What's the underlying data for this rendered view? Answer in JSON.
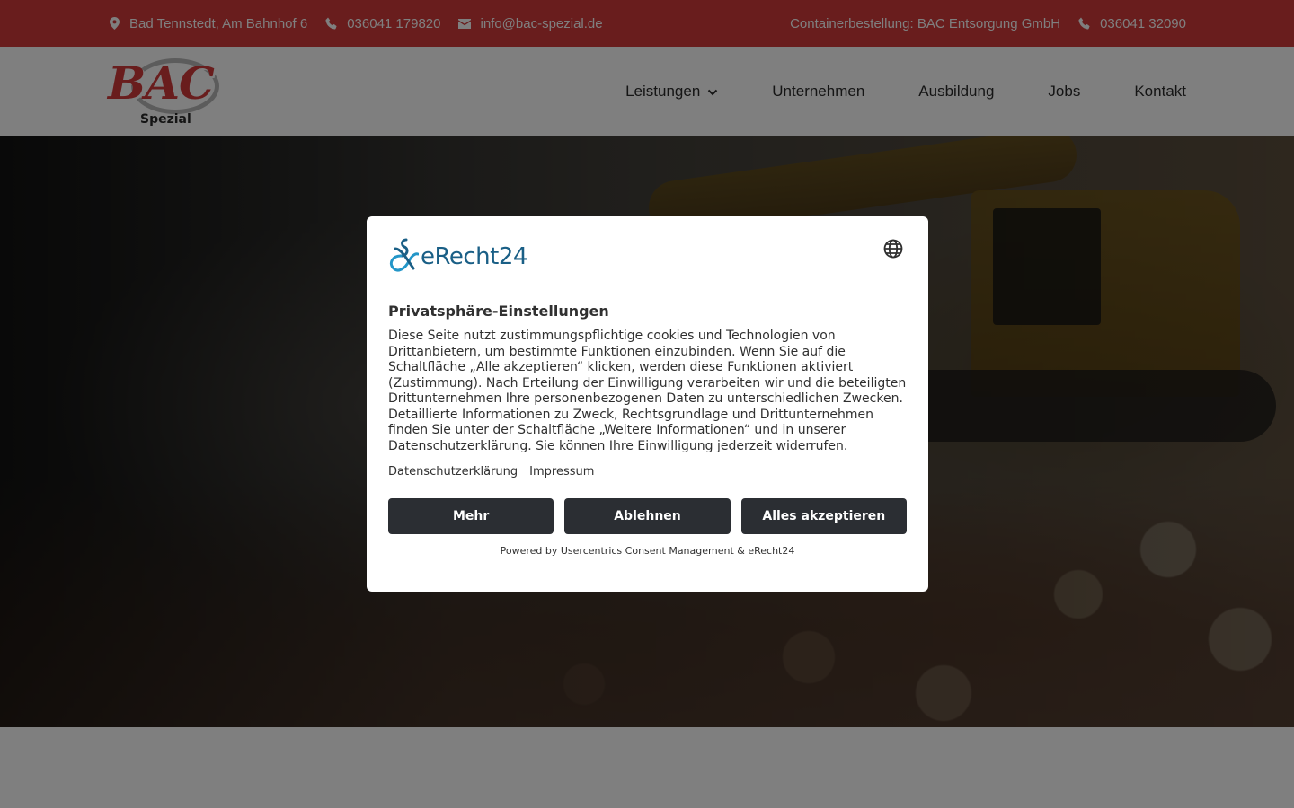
{
  "topbar": {
    "address": "Bad Tennstedt, Am Bahnhof 6",
    "phone": "036041 179820",
    "email": "info@bac-spezial.de",
    "container_order": "Containerbestellung: BAC Entsorgung GmbH",
    "container_phone": "036041 32090"
  },
  "logo": {
    "main": "BAC",
    "sub": "Spezial"
  },
  "nav": {
    "items": [
      {
        "label": "Leistungen"
      },
      {
        "label": "Unternehmen"
      },
      {
        "label": "Ausbildung"
      },
      {
        "label": "Jobs"
      },
      {
        "label": "Kontakt"
      }
    ]
  },
  "consent": {
    "brand": "eRecht24",
    "title": "Privatsphäre-Einstellungen",
    "text": "Diese Seite nutzt zustimmungspflichtige cookies und Technologien von Drittanbietern, um bestimmte Funktionen einzubinden. Wenn Sie auf die Schaltfläche „Alle akzeptieren“ klicken, werden diese Funktionen aktiviert (Zustimmung). Nach Erteilung der Einwilligung verarbeiten wir und die beteiligten Drittunternehmen Ihre personenbezogenen Daten zu unterschiedlichen Zwecken. Detaillierte Informationen zu Zweck, Rechtsgrundlage und Drittunternehmen finden Sie unter der Schaltfläche „Weitere Informationen“ und in unserer Datenschutzerklärung. Sie können Ihre Einwilligung jederzeit widerrufen.",
    "link_privacy": "Datenschutzerklärung",
    "link_imprint": "Impressum",
    "btn_more": "Mehr",
    "btn_decline": "Ablehnen",
    "btn_accept": "Alles akzeptieren",
    "powered_by": "Powered by Usercentrics Consent Management & eRecht24"
  },
  "colors": {
    "brand_red": "#d23b3b",
    "button_dark": "#2b2e33",
    "erecht_blue": "#1a5f86"
  },
  "icons": [
    "map-pin-icon",
    "phone-icon",
    "mail-icon",
    "chevron-down-icon",
    "globe-icon",
    "erecht24-logo-icon"
  ]
}
